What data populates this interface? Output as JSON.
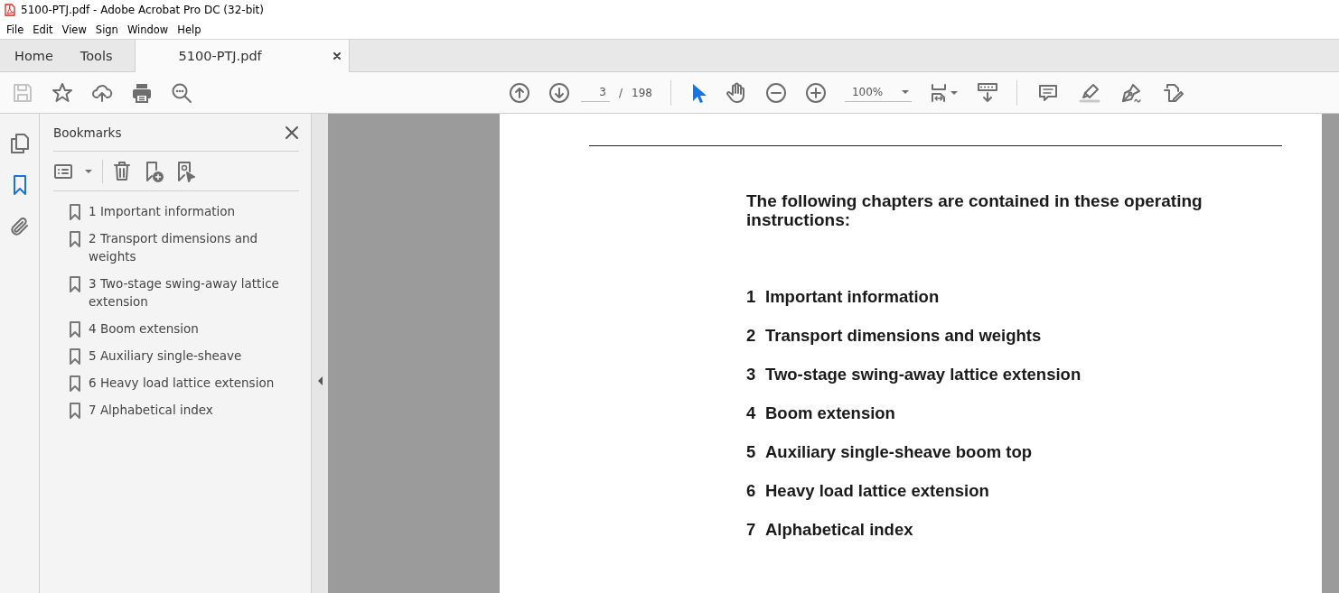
{
  "window": {
    "title": "5100-PTJ.pdf - Adobe Acrobat Pro DC (32-bit)"
  },
  "menu": [
    "File",
    "Edit",
    "View",
    "Sign",
    "Window",
    "Help"
  ],
  "tabs": [
    {
      "label": "Home",
      "selected": false
    },
    {
      "label": "Tools",
      "selected": false
    },
    {
      "label": "5100-PTJ.pdf",
      "selected": true
    }
  ],
  "toolbar": {
    "page": "3",
    "separator": "/",
    "total": "198",
    "zoom": "100%",
    "tools": [
      {
        "kind": "select",
        "selected": true
      },
      {
        "kind": "hand",
        "selected": false
      }
    ]
  },
  "side_rail": [
    {
      "kind": "pages",
      "selected": false
    },
    {
      "kind": "bookmarks",
      "selected": true
    },
    {
      "kind": "attachments",
      "selected": false
    }
  ],
  "bookmarks": {
    "title": "Bookmarks",
    "items": [
      "1 Important information",
      "2 Transport dimensions and weights",
      "3 Two-stage swing-away lattice extension",
      "4 Boom extension",
      "5 Auxiliary single-sheave",
      "6 Heavy load lattice extension",
      "7 Alphabetical index"
    ]
  },
  "document": {
    "heading": "The following chapters are contained in these operating instructions:",
    "chapters": [
      {
        "number": "1",
        "title": "Important information"
      },
      {
        "number": "2",
        "title": "Transport dimensions and weights"
      },
      {
        "number": "3",
        "title": "Two-stage swing-away lattice extension"
      },
      {
        "number": "4",
        "title": "Boom extension"
      },
      {
        "number": "5",
        "title": "Auxiliary single-sheave boom top"
      },
      {
        "number": "6",
        "title": "Heavy load lattice extension"
      },
      {
        "number": "7",
        "title": "Alphabetical index"
      }
    ]
  }
}
